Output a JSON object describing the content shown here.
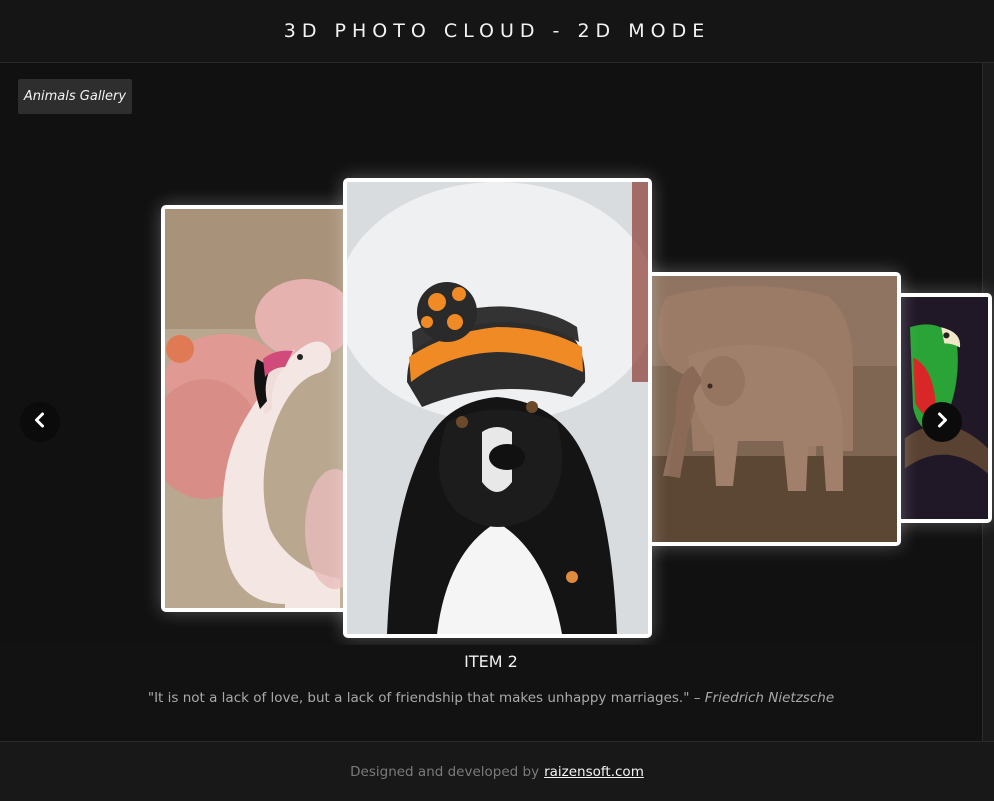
{
  "header": {
    "title": "3D PHOTO CLOUD - 2D MODE"
  },
  "gallery_button": {
    "label": "Animals Gallery"
  },
  "nav": {
    "prev_icon": "chevron-left-icon",
    "next_icon": "chevron-right-icon"
  },
  "carousel": {
    "items": [
      {
        "subject": "flamingo"
      },
      {
        "subject": "dog in beanie"
      },
      {
        "subject": "elephants"
      },
      {
        "subject": "parrot"
      }
    ]
  },
  "caption": {
    "title": "ITEM 2",
    "quote": "\"It is not a lack of love, but a lack of friendship that makes unhappy marriages.\" –",
    "author": "Friedrich Nietzsche"
  },
  "footer": {
    "text": "Designed and developed by",
    "link": "raizensoft.com"
  },
  "colors": {
    "background": "#111111",
    "header": "#151515",
    "button": "#2e2e2e",
    "frame": "#ffffff"
  }
}
